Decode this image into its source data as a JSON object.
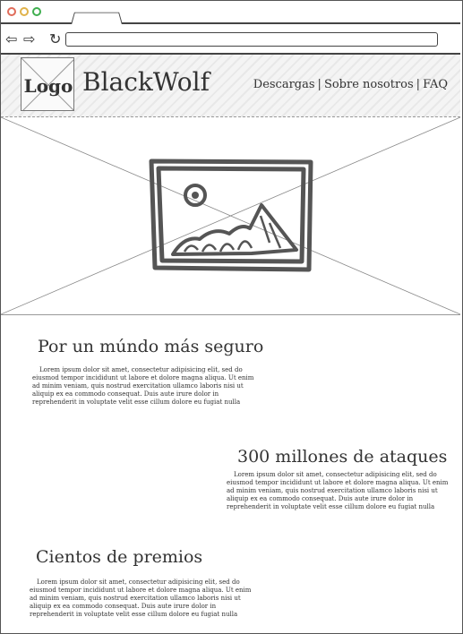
{
  "header": {
    "logo_label": "Logo",
    "brand": "BlackWolf",
    "nav": [
      "Descargas",
      "Sobre nosotros",
      "FAQ"
    ],
    "nav_separator": "|"
  },
  "browser": {
    "dots": [
      "#e06c5a",
      "#e0b24a",
      "#3fae4f"
    ],
    "back_icon": "⇦",
    "forward_icon": "⇨",
    "reload_icon": "↻"
  },
  "hero": {
    "icon": "image-placeholder-icon"
  },
  "sections": [
    {
      "title": "Por un múndo más seguro",
      "text": "Lorem ipsum dolor sit amet, consectetur adipisicing elit, sed do eiusmod tempor incididunt ut labore et dolore magna aliqua. Ut enim ad minim veniam, quis nostrud exercitation ullamco laboris nisi ut aliquip ex ea commodo consequat. Duis aute irure dolor in reprehenderit in voluptate velit esse cillum dolore eu fugiat nulla"
    },
    {
      "title": "300 millones de ataques",
      "text": "Lorem ipsum dolor sit amet, consectetur adipisicing elit, sed do eiusmod tempor incididunt ut labore et dolore magna aliqua. Ut enim ad minim veniam, quis nostrud exercitation ullamco laboris nisi ut aliquip ex ea commodo consequat. Duis aute irure dolor in reprehenderit in voluptate velit esse cillum dolore eu fugiat nulla"
    },
    {
      "title": "Cientos de premios",
      "text": "Lorem ipsum dolor sit amet, consectetur adipisicing elit, sed do eiusmod tempor incididunt ut labore et dolore magna aliqua. Ut enim ad minim veniam, quis nostrud exercitation ullamco laboris nisi ut aliquip ex ea commodo consequat. Duis aute irure dolor in reprehenderit in voluptate velit esse cillum dolore eu fugiat nulla pariatur. Excepteur sint"
    }
  ]
}
